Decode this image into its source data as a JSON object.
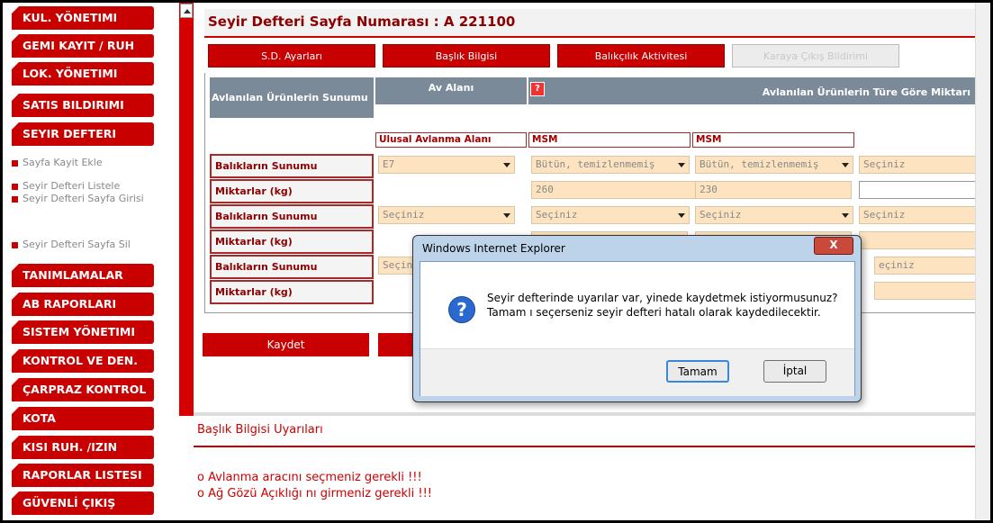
{
  "sidebar": {
    "items": [
      {
        "label": "KUL. YÖNETIMI"
      },
      {
        "label": "GEMI KAYIT / RUH"
      },
      {
        "label": "LOK. YÖNETIMI"
      },
      {
        "label": "SATIS BILDIRIMI"
      },
      {
        "label": "SEYIR DEFTERI"
      },
      {
        "label": "TANIMLAMALAR"
      },
      {
        "label": "AB RAPORLARI"
      },
      {
        "label": "SISTEM YÖNETIMI"
      },
      {
        "label": "KONTROL VE DEN."
      },
      {
        "label": "ÇARPRAZ KONTROL"
      },
      {
        "label": "KOTA"
      },
      {
        "label": "KISI RUH. /IZIN"
      },
      {
        "label": "RAPORLAR LISTESI"
      },
      {
        "label": "GÜVENLİ ÇIKIŞ"
      }
    ],
    "subitems": [
      {
        "label": "Sayfa Kayit Ekle"
      },
      {
        "label": "Seyir Defteri Listele"
      },
      {
        "label": "Seyir Defteri Sayfa Girisi"
      },
      {
        "label": "Seyir Defteri Sayfa Sil"
      }
    ]
  },
  "header": {
    "title": "Seyir Defteri Sayfa Numarası :  A 221100"
  },
  "tabs": [
    {
      "label": "S.D. Ayarları"
    },
    {
      "label": "Başlık Bilgisi"
    },
    {
      "label": "Balıkçılık Aktivitesi"
    },
    {
      "label": "Karaya Çıkış Bildirimi"
    }
  ],
  "grid": {
    "header_left": "Avlanılan Ürünlerin Sunumu",
    "header_area": "Av Alanı",
    "header_area_sub": "Ulusal Avlanma Alanı",
    "header_amounts": "Avlanılan Ürünlerin Türe Göre Miktarı",
    "question_mark": "?",
    "species_1": "MSM",
    "species_2": "MSM",
    "rows": [
      {
        "label": "Balıkların Sunumu",
        "area": "E7",
        "c1": "Bütün, temizlenmemiş",
        "c2": "Bütün, temizlenmemiş",
        "c3": "Seçiniz"
      },
      {
        "label": "Miktarlar (kg)",
        "c1": "260",
        "c2": "230",
        "c3": ""
      },
      {
        "label": "Balıkların Sunumu",
        "area": "Seçiniz",
        "c1": "Seçiniz",
        "c2": "Seçiniz",
        "c3": "Seçiniz"
      },
      {
        "label": "Miktarlar (kg)",
        "c1": "",
        "c2": "",
        "c3": ""
      },
      {
        "label": "Balıkların Sunumu",
        "area": "Seçin",
        "c3": "eçiniz"
      },
      {
        "label": "Miktarlar (kg)"
      }
    ]
  },
  "actions": {
    "save_label": "Kaydet"
  },
  "warnings": {
    "title": "Başlık Bilgisi Uyarıları",
    "items": [
      "o Avlanma aracını seçmeniz gerekli !!!",
      "o Ağ Gözü Açıklığı nı girmeniz gerekli !!!"
    ]
  },
  "dialog": {
    "title": "Windows Internet Explorer",
    "close": "X",
    "message_line1": "Seyir defterinde uyarılar var, yinede kaydetmek istiyormusunuz?",
    "message_line2": "Tamam ı seçerseniz seyir defteri hatalı olarak kaydedilecektir.",
    "ok_label": "Tamam",
    "cancel_label": "İptal",
    "icon": "question-icon"
  },
  "colors": {
    "accent": "#c80000",
    "header_bg": "#7a8a99",
    "field_bg": "#fde3bf"
  }
}
